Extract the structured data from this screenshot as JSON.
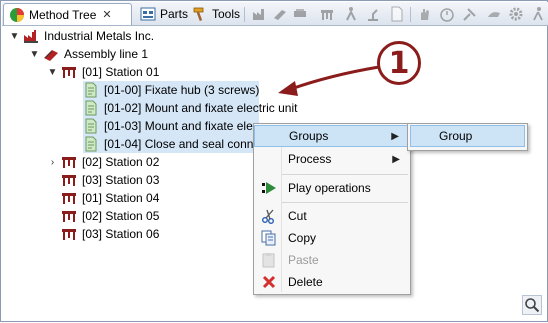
{
  "tabs": [
    {
      "label": "Method Tree",
      "active": true,
      "close": "✕"
    },
    {
      "label": "Parts"
    },
    {
      "label": "Tools"
    }
  ],
  "tree": [
    {
      "label": "Industrial Metals Inc.",
      "icon": "factory-icon",
      "toggle": "▼"
    },
    {
      "label": "Assembly line 1",
      "icon": "assembly-line-icon",
      "toggle": "▼"
    },
    {
      "label": "[01] Station 01",
      "icon": "station-icon",
      "toggle": "▼"
    },
    {
      "label": "[01-00] Fixate hub (3 screws)",
      "icon": "operation-icon",
      "selected": true
    },
    {
      "label": "[01-02] Mount and fixate electric unit",
      "icon": "operation-icon",
      "selected": true
    },
    {
      "label": "[01-03] Mount and fixate ele",
      "icon": "operation-icon",
      "selected": true
    },
    {
      "label": "[01-04] Close and seal conn",
      "icon": "operation-icon",
      "selected": true
    },
    {
      "label": "[02] Station 02",
      "icon": "station-icon",
      "toggle": "›"
    },
    {
      "label": "[03] Station 03",
      "icon": "station-icon"
    },
    {
      "label": "[01] Station 04",
      "icon": "station-icon"
    },
    {
      "label": "[02] Station 05",
      "icon": "station-icon"
    },
    {
      "label": "[03] Station 06",
      "icon": "station-icon"
    }
  ],
  "context_menu": {
    "items": [
      {
        "label": "Groups",
        "submenu": true,
        "hover": true
      },
      {
        "label": "Process",
        "submenu": true
      },
      {
        "label": "Play operations",
        "icon": "play-operations-icon"
      },
      {
        "label": "Cut",
        "icon": "scissors-icon"
      },
      {
        "label": "Copy",
        "icon": "copy-icon"
      },
      {
        "label": "Paste",
        "icon": "paste-icon",
        "disabled": true
      },
      {
        "label": "Delete",
        "icon": "delete-icon"
      }
    ]
  },
  "submenu": {
    "items": [
      {
        "label": "Group"
      }
    ]
  },
  "callout": {
    "number": "1"
  },
  "colors": {
    "accent": "#8b1c1c",
    "selection": "#d5e6f7",
    "menu_hover": "#cde4f7"
  }
}
